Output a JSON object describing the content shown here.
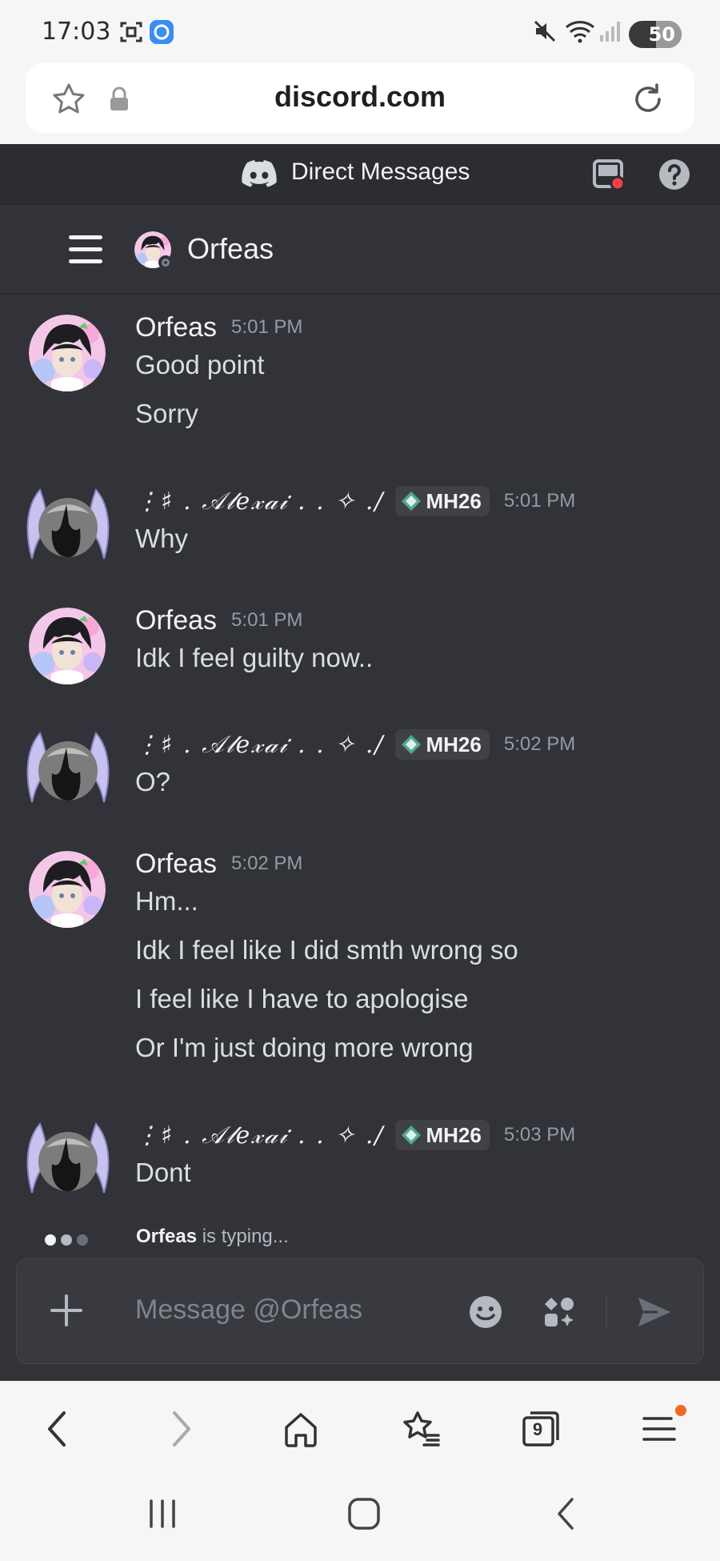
{
  "status_bar": {
    "time": "17:03",
    "battery": "50"
  },
  "browser": {
    "url": "discord.com",
    "tabs_count": "9"
  },
  "discord": {
    "top_title": "Direct Messages",
    "channel": {
      "name": "Orfeas"
    },
    "messages": [
      {
        "author": "Orfeas",
        "time": "5:01 PM",
        "lines": [
          "Good point",
          "Sorry"
        ]
      },
      {
        "author": "⋮♯ . 𝒜𝓁𝑒𝓍𝒶𝒾 . . ✧ ./",
        "tag": "MH26",
        "time": "5:01 PM",
        "lines": [
          "Why"
        ]
      },
      {
        "author": "Orfeas",
        "time": "5:01 PM",
        "lines": [
          "Idk I feel guilty now.."
        ]
      },
      {
        "author": "⋮♯ . 𝒜𝓁𝑒𝓍𝒶𝒾 . . ✧ ./",
        "tag": "MH26",
        "time": "5:02 PM",
        "lines": [
          "O?"
        ]
      },
      {
        "author": "Orfeas",
        "time": "5:02 PM",
        "lines": [
          "Hm...",
          "Idk I feel like I did smth wrong so",
          "I feel like I have to apologise",
          "Or I'm just doing more wrong"
        ]
      },
      {
        "author": "⋮♯ . 𝒜𝓁𝑒𝓍𝒶𝒾 . . ✧ ./",
        "tag": "MH26",
        "time": "5:03 PM",
        "lines": [
          "Dont"
        ]
      }
    ],
    "typing": {
      "user": "Orfeas",
      "suffix": " is typing..."
    },
    "composer": {
      "placeholder": "Message @Orfeas"
    }
  },
  "colors": {
    "background": "#313338",
    "header": "#2b2d31",
    "text": "#dbdee1",
    "muted": "#949ba4",
    "accent_red": "#f23f43"
  },
  "icons": [
    "star-icon",
    "lock-icon",
    "reload-icon",
    "discord-logo-icon",
    "inbox-icon",
    "help-icon",
    "hamburger-icon",
    "plus-icon",
    "emoji-icon",
    "apps-icon",
    "send-icon",
    "back-icon",
    "forward-icon",
    "home-icon",
    "bookmarks-icon",
    "tabs-icon",
    "menu-icon"
  ]
}
